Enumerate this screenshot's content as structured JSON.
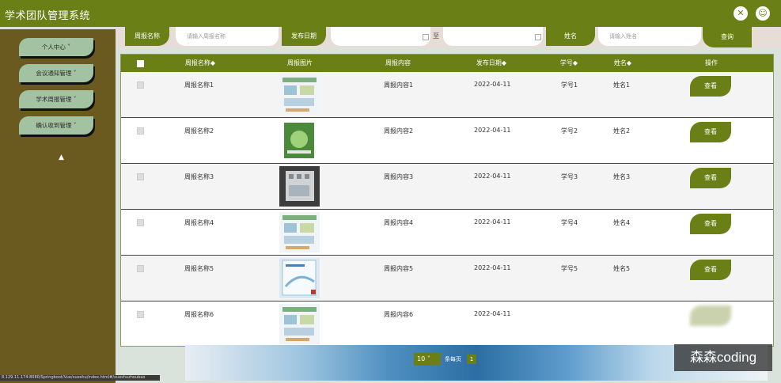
{
  "app": {
    "title": "学术团队管理系统"
  },
  "header": {
    "icons": [
      "close-icon",
      "user-icon"
    ]
  },
  "sidebar": {
    "items": [
      {
        "label": "个人中心 ˅"
      },
      {
        "label": "会议通知管理 ˅"
      },
      {
        "label": "学术周报管理 ˅"
      },
      {
        "label": "确认收到管理 ˅"
      }
    ]
  },
  "search": {
    "name_label": "周报名称",
    "name_placeholder": "请输入周报名称",
    "date_label": "发布日期",
    "to_label": "至",
    "student_name_label": "姓名",
    "student_name_placeholder": "请输入姓名",
    "search_button": "查询"
  },
  "table": {
    "headers": {
      "name": "周报名称◆",
      "image": "周报图片",
      "content": "周报内容",
      "date": "发布日期◆",
      "student_no": "学号◆",
      "student_name": "姓名◆",
      "action": "操作"
    },
    "view_label": "查看",
    "rows": [
      {
        "name": "周报名称1",
        "content": "周报内容1",
        "date": "2022-04-11",
        "student_no": "学号1",
        "student_name": "姓名1"
      },
      {
        "name": "周报名称2",
        "content": "周报内容2",
        "date": "2022-04-11",
        "student_no": "学号2",
        "student_name": "姓名2"
      },
      {
        "name": "周报名称3",
        "content": "周报内容3",
        "date": "2022-04-11",
        "student_no": "学号3",
        "student_name": "姓名3"
      },
      {
        "name": "周报名称4",
        "content": "周报内容4",
        "date": "2022-04-11",
        "student_no": "学号4",
        "student_name": "姓名4"
      },
      {
        "name": "周报名称5",
        "content": "周报内容5",
        "date": "2022-04-11",
        "student_no": "学号5",
        "student_name": "姓名5"
      },
      {
        "name": "周报名称6",
        "content": "周报内容6",
        "date": "2022-04-11",
        "student_no": "",
        "student_name": ""
      }
    ]
  },
  "chart_data": {
    "type": "table",
    "columns": [
      "周报名称",
      "周报图片",
      "周报内容",
      "发布日期",
      "学号",
      "姓名",
      "操作"
    ],
    "rows": [
      [
        "周报名称1",
        "",
        "周报内容1",
        "2022-04-11",
        "学号1",
        "姓名1",
        "查看"
      ],
      [
        "周报名称2",
        "",
        "周报内容2",
        "2022-04-11",
        "学号2",
        "姓名2",
        "查看"
      ],
      [
        "周报名称3",
        "",
        "周报内容3",
        "2022-04-11",
        "学号3",
        "姓名3",
        "查看"
      ],
      [
        "周报名称4",
        "",
        "周报内容4",
        "2022-04-11",
        "学号4",
        "姓名4",
        "查看"
      ],
      [
        "周报名称5",
        "",
        "周报内容5",
        "2022-04-11",
        "学号5",
        "姓名5",
        "查看"
      ],
      [
        "周报名称6",
        "",
        "周报内容6",
        "2022-04-11",
        "",
        "",
        ""
      ]
    ]
  },
  "pager": {
    "page_size": "10",
    "per_page_label": "条每页",
    "current_page": "1"
  },
  "watermark": "森森coding",
  "status_bar": "8.129.11.174:8080/Springboot/Vue/xueshu/index.html#/xueshuzhoubao"
}
